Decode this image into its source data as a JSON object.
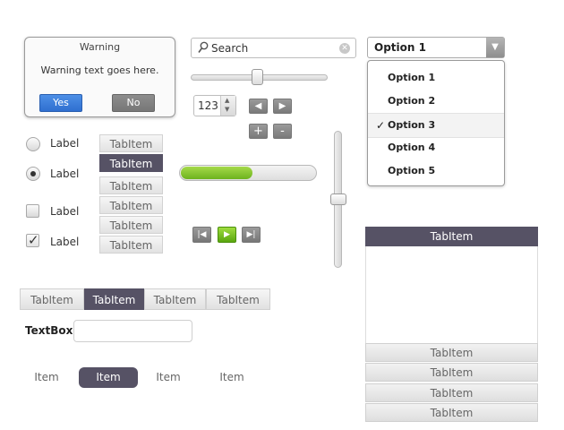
{
  "dialog": {
    "title": "Warning",
    "message": "Warning text goes here.",
    "yes": "Yes",
    "no": "No"
  },
  "search": {
    "placeholder": "Search"
  },
  "stepper": {
    "value": "123"
  },
  "select": {
    "value": "Option 1",
    "options": [
      "Option 1",
      "Option 2",
      "Option 3",
      "Option 4",
      "Option 5"
    ],
    "checked_index": 2,
    "check_mark": "✓"
  },
  "radios": [
    {
      "label": "Label",
      "checked": false
    },
    {
      "label": "Label",
      "checked": true
    }
  ],
  "checks": [
    {
      "label": "Label",
      "checked": false
    },
    {
      "label": "Label",
      "checked": true
    }
  ],
  "vertical_tabs": [
    "TabItem",
    "TabItem",
    "TabItem",
    "TabItem",
    "TabItem",
    "TabItem"
  ],
  "vertical_tabs_active": 1,
  "progress": {
    "value": 0.53
  },
  "horizontal_slider": {
    "value": 0.48
  },
  "vertical_slider": {
    "value": 0.5
  },
  "horizontal_tabs": [
    "TabItem",
    "TabItem",
    "TabItem",
    "TabItem"
  ],
  "horizontal_tabs_active": 1,
  "textbox": {
    "label": "TextBox",
    "value": ""
  },
  "items": [
    "Item",
    "Item",
    "Item",
    "Item"
  ],
  "items_active": 1,
  "right_tabs": {
    "top": "TabItem",
    "bottom": [
      "TabItem",
      "TabItem",
      "TabItem",
      "TabItem"
    ]
  },
  "colors": {
    "accent": "#565265",
    "progress": "#7cc22a",
    "play": "#6fba1b",
    "yes": "#3a7ad8"
  }
}
